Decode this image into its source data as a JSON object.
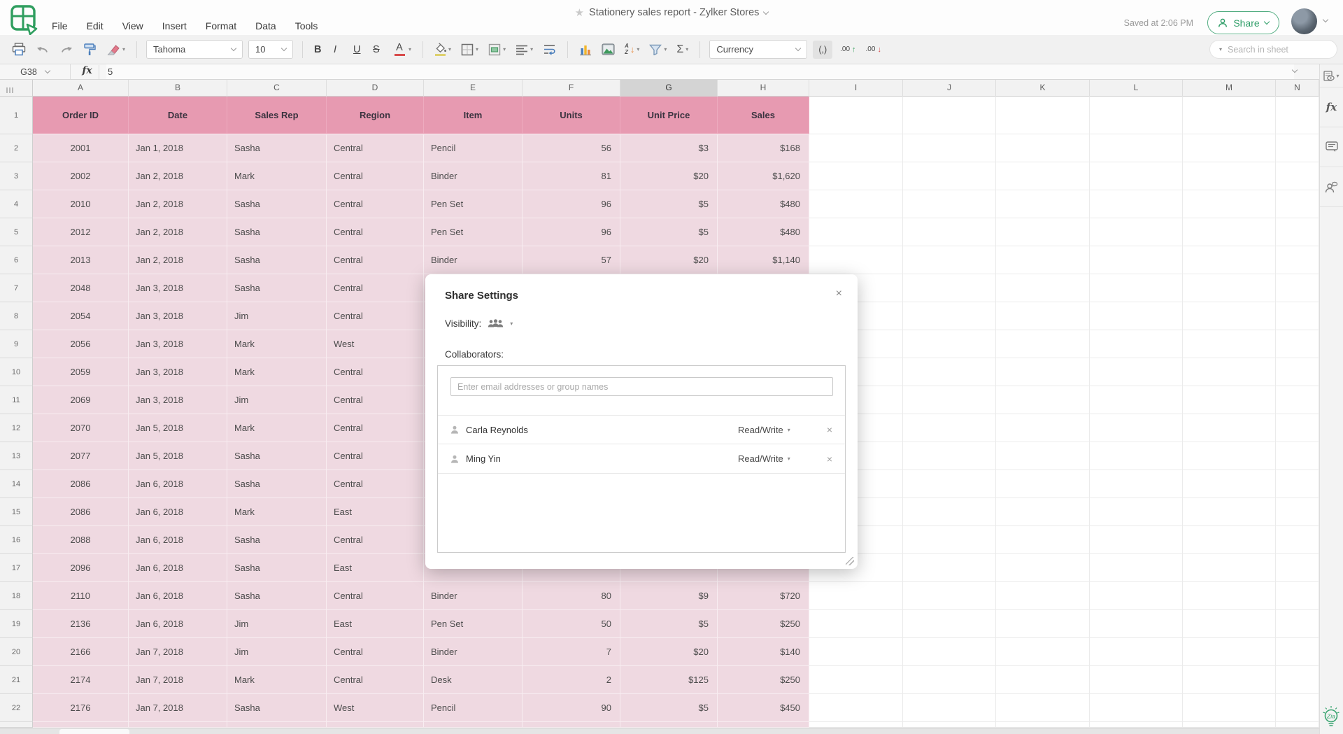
{
  "app": {
    "menu": [
      "File",
      "Edit",
      "View",
      "Insert",
      "Format",
      "Data",
      "Tools"
    ],
    "doc_title": "Stationery sales report - Zylker Stores",
    "saved_status": "Saved at 2:06 PM",
    "share_label": "Share"
  },
  "toolbar": {
    "font_name": "Tahoma",
    "font_size": "10",
    "bold": "B",
    "italic": "I",
    "underline": "U",
    "strikethrough": "S",
    "font_color": "A",
    "sort_a": "A",
    "sort_z": "Z",
    "sum": "Σ",
    "number_format": "Currency",
    "comma_style": "(,)",
    "increase_decimal": ".00",
    "decrease_decimal": ".00",
    "search_placeholder": "Search in sheet"
  },
  "formula_bar": {
    "cell_ref": "G38",
    "fx_label": "fx",
    "value": "5"
  },
  "right_panel": {
    "functions_label": "fx"
  },
  "sheet": {
    "columns": [
      "A",
      "B",
      "C",
      "D",
      "E",
      "F",
      "G",
      "H",
      "I",
      "J",
      "K",
      "L",
      "M",
      "N"
    ],
    "active_column": "G",
    "header": [
      "Order ID",
      "Date",
      "Sales Rep",
      "Region",
      "Item",
      "Units",
      "Unit Price",
      "Sales"
    ],
    "rows": [
      {
        "n": 2,
        "cells": [
          "2001",
          "Jan 1, 2018",
          "Sasha",
          "Central",
          "Pencil",
          "56",
          "$3",
          "$168"
        ]
      },
      {
        "n": 3,
        "cells": [
          "2002",
          "Jan 2, 2018",
          "Mark",
          "Central",
          "Binder",
          "81",
          "$20",
          "$1,620"
        ]
      },
      {
        "n": 4,
        "cells": [
          "2010",
          "Jan 2, 2018",
          "Sasha",
          "Central",
          "Pen Set",
          "96",
          "$5",
          "$480"
        ]
      },
      {
        "n": 5,
        "cells": [
          "2012",
          "Jan 2, 2018",
          "Sasha",
          "Central",
          "Pen Set",
          "96",
          "$5",
          "$480"
        ]
      },
      {
        "n": 6,
        "cells": [
          "2013",
          "Jan 2, 2018",
          "Sasha",
          "Central",
          "Binder",
          "57",
          "$20",
          "$1,140"
        ]
      },
      {
        "n": 7,
        "cells": [
          "2048",
          "Jan 3, 2018",
          "Sasha",
          "Central",
          "",
          "",
          "",
          ""
        ]
      },
      {
        "n": 8,
        "cells": [
          "2054",
          "Jan 3, 2018",
          "Jim",
          "Central",
          "",
          "",
          "",
          ""
        ]
      },
      {
        "n": 9,
        "cells": [
          "2056",
          "Jan 3, 2018",
          "Mark",
          "West",
          "",
          "",
          "",
          ""
        ]
      },
      {
        "n": 10,
        "cells": [
          "2059",
          "Jan 3, 2018",
          "Mark",
          "Central",
          "",
          "",
          "",
          ""
        ]
      },
      {
        "n": 11,
        "cells": [
          "2069",
          "Jan 3, 2018",
          "Jim",
          "Central",
          "",
          "",
          "",
          ""
        ]
      },
      {
        "n": 12,
        "cells": [
          "2070",
          "Jan 5, 2018",
          "Mark",
          "Central",
          "",
          "",
          "",
          ""
        ]
      },
      {
        "n": 13,
        "cells": [
          "2077",
          "Jan 5, 2018",
          "Sasha",
          "Central",
          "",
          "",
          "",
          ""
        ]
      },
      {
        "n": 14,
        "cells": [
          "2086",
          "Jan 6, 2018",
          "Sasha",
          "Central",
          "",
          "",
          "",
          ""
        ]
      },
      {
        "n": 15,
        "cells": [
          "2086",
          "Jan 6, 2018",
          "Mark",
          "East",
          "",
          "",
          "",
          ""
        ]
      },
      {
        "n": 16,
        "cells": [
          "2088",
          "Jan 6, 2018",
          "Sasha",
          "Central",
          "",
          "",
          "",
          ""
        ]
      },
      {
        "n": 17,
        "cells": [
          "2096",
          "Jan 6, 2018",
          "Sasha",
          "East",
          "",
          "",
          "",
          ""
        ]
      },
      {
        "n": 18,
        "cells": [
          "2110",
          "Jan 6, 2018",
          "Sasha",
          "Central",
          "Binder",
          "80",
          "$9",
          "$720"
        ]
      },
      {
        "n": 19,
        "cells": [
          "2136",
          "Jan 6, 2018",
          "Jim",
          "East",
          "Pen Set",
          "50",
          "$5",
          "$250"
        ]
      },
      {
        "n": 20,
        "cells": [
          "2166",
          "Jan 7, 2018",
          "Jim",
          "Central",
          "Binder",
          "7",
          "$20",
          "$140"
        ]
      },
      {
        "n": 21,
        "cells": [
          "2174",
          "Jan 7, 2018",
          "Mark",
          "Central",
          "Desk",
          "2",
          "$125",
          "$250"
        ]
      },
      {
        "n": 22,
        "cells": [
          "2176",
          "Jan 7, 2018",
          "Sasha",
          "West",
          "Pencil",
          "90",
          "$5",
          "$450"
        ]
      }
    ]
  },
  "dialog": {
    "title": "Share Settings",
    "visibility_label": "Visibility:",
    "collaborators_label": "Collaborators:",
    "input_placeholder": "Enter email addresses or group names",
    "collaborators": [
      {
        "name": "Carla Reynolds",
        "permission": "Read/Write"
      },
      {
        "name": "Ming Yin",
        "permission": "Read/Write"
      }
    ]
  },
  "colors": {
    "accent_green": "#2f9e68",
    "table_header_pink": "#e79ab1",
    "table_row_pink": "#efd9e1",
    "active_column_gray": "#d4d4d4"
  }
}
